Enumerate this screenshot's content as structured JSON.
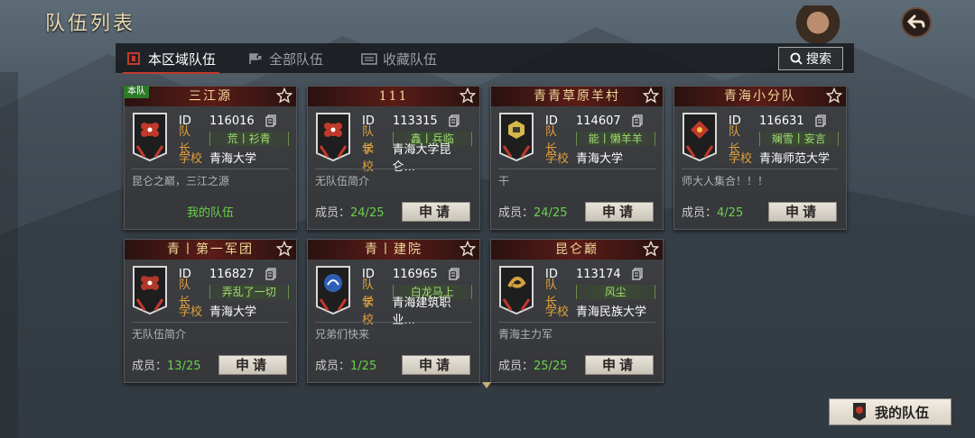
{
  "page": {
    "title": "队伍列表"
  },
  "tabs": [
    {
      "label": "本区域队伍",
      "active": true,
      "icon": "flag-banner-icon"
    },
    {
      "label": "全部队伍",
      "active": false,
      "icon": "flag-group-icon"
    },
    {
      "label": "收藏队伍",
      "active": false,
      "icon": "bookmark-box-icon"
    }
  ],
  "search": {
    "label": "搜索",
    "icon": "search-icon"
  },
  "labels": {
    "id": "ID",
    "leader": "队长",
    "school": "学校",
    "members": "成员：",
    "apply": "申请",
    "own_tag": "本队",
    "my_team_link": "我的队伍"
  },
  "teams": [
    {
      "name": "三江源",
      "id": "116016",
      "leader": "荒丨衫青",
      "school": "青海大学",
      "intro": "昆仑之巅，三江之源",
      "members": "",
      "own": true,
      "emblem": "#c0392b",
      "symbol": "flower"
    },
    {
      "name": "111",
      "id": "113315",
      "leader": "鑫丨兵临",
      "school": "青海大学昆仑...",
      "intro": "无队伍简介",
      "members": "24/25",
      "own": false,
      "emblem": "#c0392b",
      "symbol": "flower"
    },
    {
      "name": "青青草原羊村",
      "id": "114607",
      "leader": "能丨懒羊羊",
      "school": "青海大学",
      "intro": "干",
      "members": "24/25",
      "own": false,
      "emblem": "#d4b84a",
      "symbol": "hex"
    },
    {
      "name": "青海小分队",
      "id": "116631",
      "leader": "斓雪丨妄言",
      "school": "青海师范大学",
      "intro": "师大人集合！！！",
      "members": "4/25",
      "own": false,
      "emblem": "#c0392b",
      "symbol": "diamond"
    },
    {
      "name": "青丨第一军团",
      "id": "116827",
      "leader": "弄乱了一切",
      "school": "青海大学",
      "intro": "无队伍简介",
      "members": "13/25",
      "own": false,
      "emblem": "#b0392b",
      "symbol": "flower"
    },
    {
      "name": "青丨建院",
      "id": "116965",
      "leader": "白龙马上",
      "school": "青海建筑职业...",
      "intro": "兄弟们快来",
      "members": "1/25",
      "own": false,
      "emblem": "#2f5fb5",
      "symbol": "circle"
    },
    {
      "name": "昆仑巅",
      "id": "113174",
      "leader": "风尘",
      "school": "青海民族大学",
      "intro": "青海主力军",
      "members": "25/25",
      "own": false,
      "emblem": "#d4a040",
      "symbol": "swirl"
    }
  ],
  "my_team_button": {
    "label": "我的队伍",
    "icon": "team-banner-icon"
  },
  "colors": {
    "accent_red": "#c43a2c",
    "label_orange": "#e2a03c",
    "green": "#6cd04a",
    "title_gold": "#f0d89a"
  }
}
